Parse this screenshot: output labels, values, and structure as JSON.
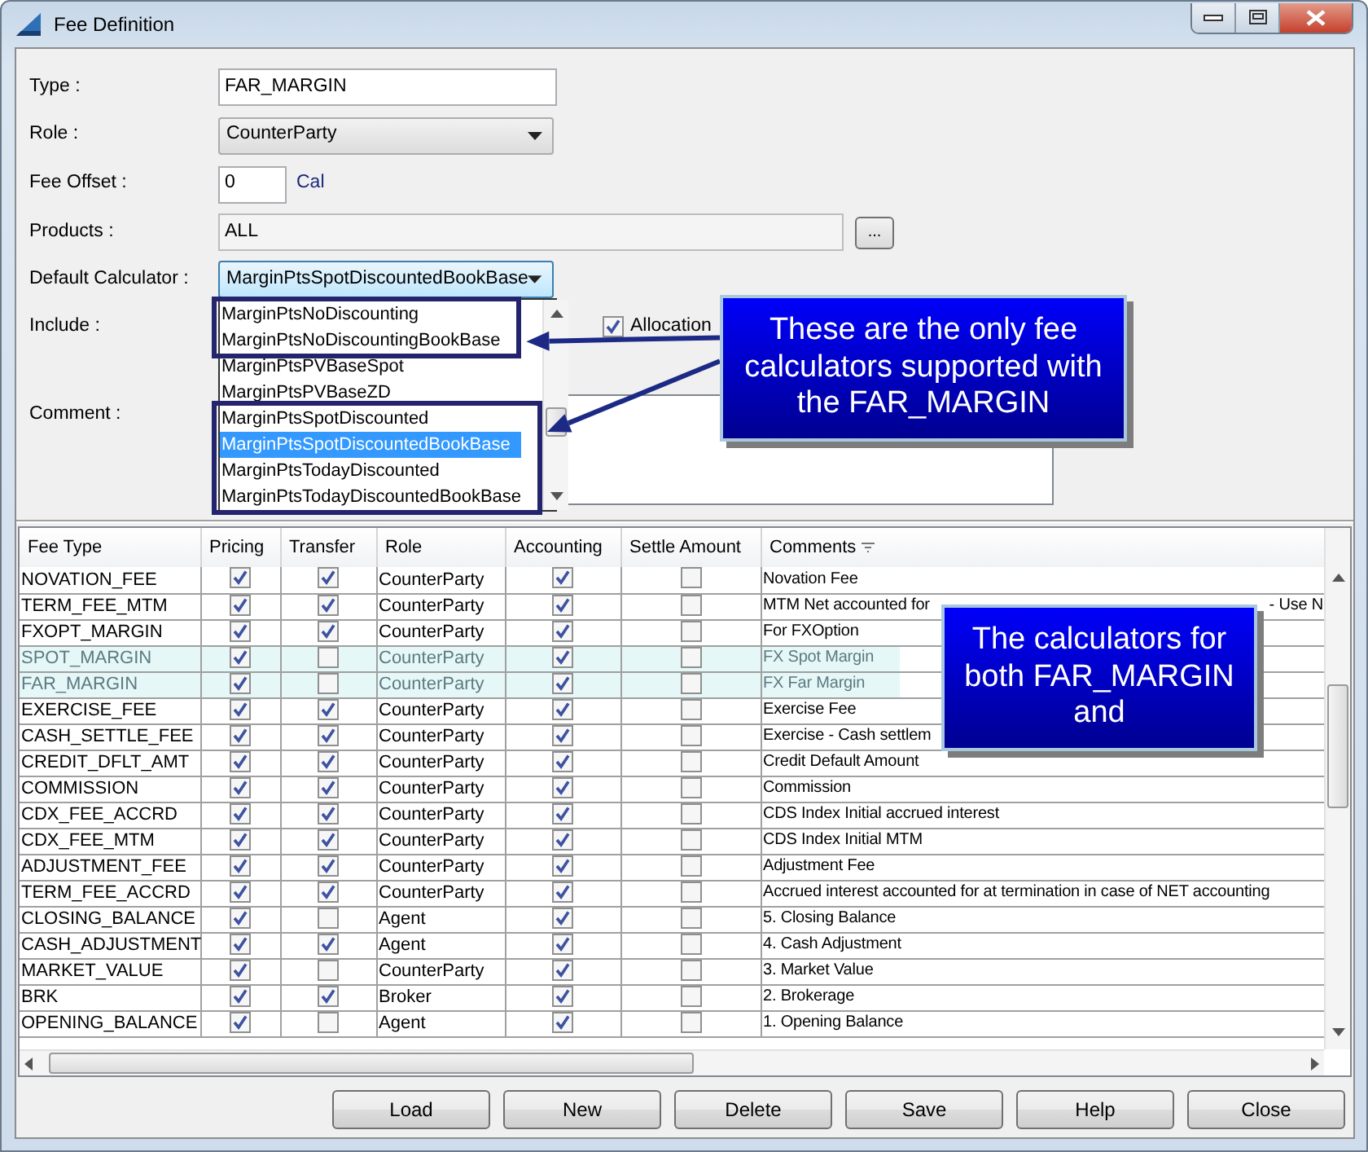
{
  "window": {
    "title": "Fee Definition"
  },
  "form": {
    "type": {
      "label": "Type :",
      "value": "FAR_MARGIN"
    },
    "role": {
      "label": "Role :",
      "value": "CounterParty"
    },
    "fee_offset": {
      "label": "Fee Offset :",
      "value": "0",
      "unit": "Cal"
    },
    "products": {
      "label": "Products :",
      "value": "ALL",
      "button": "..."
    },
    "default_calculator": {
      "label": "Default Calculator :",
      "value": "MarginPtsSpotDiscountedBookBase",
      "expanded": true,
      "options": [
        {
          "label": "MarginPtsNoDiscounting",
          "selected": false,
          "framed": true
        },
        {
          "label": "MarginPtsNoDiscountingBookBase",
          "selected": false,
          "framed": true
        },
        {
          "label": "MarginPtsPVBaseSpot",
          "selected": false,
          "framed": false
        },
        {
          "label": "MarginPtsPVBaseZD",
          "selected": false,
          "framed": false
        },
        {
          "label": "MarginPtsSpotDiscounted",
          "selected": false,
          "framed": true
        },
        {
          "label": "MarginPtsSpotDiscountedBookBase",
          "selected": true,
          "framed": true
        },
        {
          "label": "MarginPtsTodayDiscounted",
          "selected": false,
          "framed": true
        },
        {
          "label": "MarginPtsTodayDiscountedBookBase",
          "selected": false,
          "framed": true
        }
      ]
    },
    "include": {
      "label": "Include :",
      "options": [
        {
          "label": "Allocation",
          "checked": true
        }
      ]
    },
    "comment": {
      "label": "Comment :"
    }
  },
  "table": {
    "columns": [
      "Fee Type",
      "Pricing",
      "Transfer",
      "Role",
      "Accounting",
      "Settle Amount",
      "Comments"
    ],
    "rows": [
      {
        "fee_type": "NOVATION_FEE",
        "pricing": true,
        "transfer": true,
        "role": "CounterParty",
        "accounting": true,
        "settle_amount": false,
        "comment": "Novation Fee",
        "highlighted": false
      },
      {
        "fee_type": "TERM_FEE_MTM",
        "pricing": true,
        "transfer": true,
        "role": "CounterParty",
        "accounting": true,
        "settle_amount": false,
        "comment": "MTM Net accounted for",
        "comment_end": "- Use N",
        "highlighted": false
      },
      {
        "fee_type": "FXOPT_MARGIN",
        "pricing": true,
        "transfer": true,
        "role": "CounterParty",
        "accounting": true,
        "settle_amount": false,
        "comment": "For FXOption",
        "highlighted": false
      },
      {
        "fee_type": "SPOT_MARGIN",
        "pricing": true,
        "transfer": false,
        "role": "CounterParty",
        "accounting": true,
        "settle_amount": false,
        "comment": "FX Spot Margin",
        "highlighted": true
      },
      {
        "fee_type": "FAR_MARGIN",
        "pricing": true,
        "transfer": false,
        "role": "CounterParty",
        "accounting": true,
        "settle_amount": false,
        "comment": "FX Far Margin",
        "highlighted": true
      },
      {
        "fee_type": "EXERCISE_FEE",
        "pricing": true,
        "transfer": true,
        "role": "CounterParty",
        "accounting": true,
        "settle_amount": false,
        "comment": "Exercise Fee",
        "highlighted": false
      },
      {
        "fee_type": "CASH_SETTLE_FEE",
        "pricing": true,
        "transfer": true,
        "role": "CounterParty",
        "accounting": true,
        "settle_amount": false,
        "comment": "Exercise - Cash settlem",
        "highlighted": false
      },
      {
        "fee_type": "CREDIT_DFLT_AMT",
        "pricing": true,
        "transfer": true,
        "role": "CounterParty",
        "accounting": true,
        "settle_amount": false,
        "comment": "Credit Default Amount",
        "highlighted": false
      },
      {
        "fee_type": "COMMISSION",
        "pricing": true,
        "transfer": true,
        "role": "CounterParty",
        "accounting": true,
        "settle_amount": false,
        "comment": "Commission",
        "highlighted": false
      },
      {
        "fee_type": "CDX_FEE_ACCRD",
        "pricing": true,
        "transfer": true,
        "role": "CounterParty",
        "accounting": true,
        "settle_amount": false,
        "comment": "CDS Index Initial accrued interest",
        "highlighted": false
      },
      {
        "fee_type": "CDX_FEE_MTM",
        "pricing": true,
        "transfer": true,
        "role": "CounterParty",
        "accounting": true,
        "settle_amount": false,
        "comment": "CDS Index Initial MTM",
        "highlighted": false
      },
      {
        "fee_type": "ADJUSTMENT_FEE",
        "pricing": true,
        "transfer": true,
        "role": "CounterParty",
        "accounting": true,
        "settle_amount": false,
        "comment": "Adjustment Fee",
        "highlighted": false
      },
      {
        "fee_type": "TERM_FEE_ACCRD",
        "pricing": true,
        "transfer": true,
        "role": "CounterParty",
        "accounting": true,
        "settle_amount": false,
        "comment": "Accrued interest accounted for at termination in case of NET accounting",
        "highlighted": false
      },
      {
        "fee_type": "CLOSING_BALANCE",
        "pricing": true,
        "transfer": false,
        "role": "Agent",
        "accounting": true,
        "settle_amount": false,
        "comment": "5. Closing Balance",
        "highlighted": false
      },
      {
        "fee_type": "CASH_ADJUSTMENT",
        "pricing": true,
        "transfer": true,
        "role": "Agent",
        "accounting": true,
        "settle_amount": false,
        "comment": "4. Cash Adjustment",
        "highlighted": false
      },
      {
        "fee_type": "MARKET_VALUE",
        "pricing": true,
        "transfer": false,
        "role": "CounterParty",
        "accounting": true,
        "settle_amount": false,
        "comment": "3. Market Value",
        "highlighted": false
      },
      {
        "fee_type": "BRK",
        "pricing": true,
        "transfer": true,
        "role": "Broker",
        "accounting": true,
        "settle_amount": false,
        "comment": "2. Brokerage",
        "highlighted": false
      },
      {
        "fee_type": "OPENING_BALANCE",
        "pricing": true,
        "transfer": false,
        "role": "Agent",
        "accounting": true,
        "settle_amount": false,
        "comment": "1. Opening Balance",
        "highlighted": false
      }
    ]
  },
  "callouts": [
    {
      "text": "These are the only fee calculators supported with the FAR_MARGIN"
    },
    {
      "text": "The calculators for both FAR_MARGIN and"
    }
  ],
  "buttons": [
    "Load",
    "New",
    "Delete",
    "Save",
    "Help",
    "Close"
  ]
}
